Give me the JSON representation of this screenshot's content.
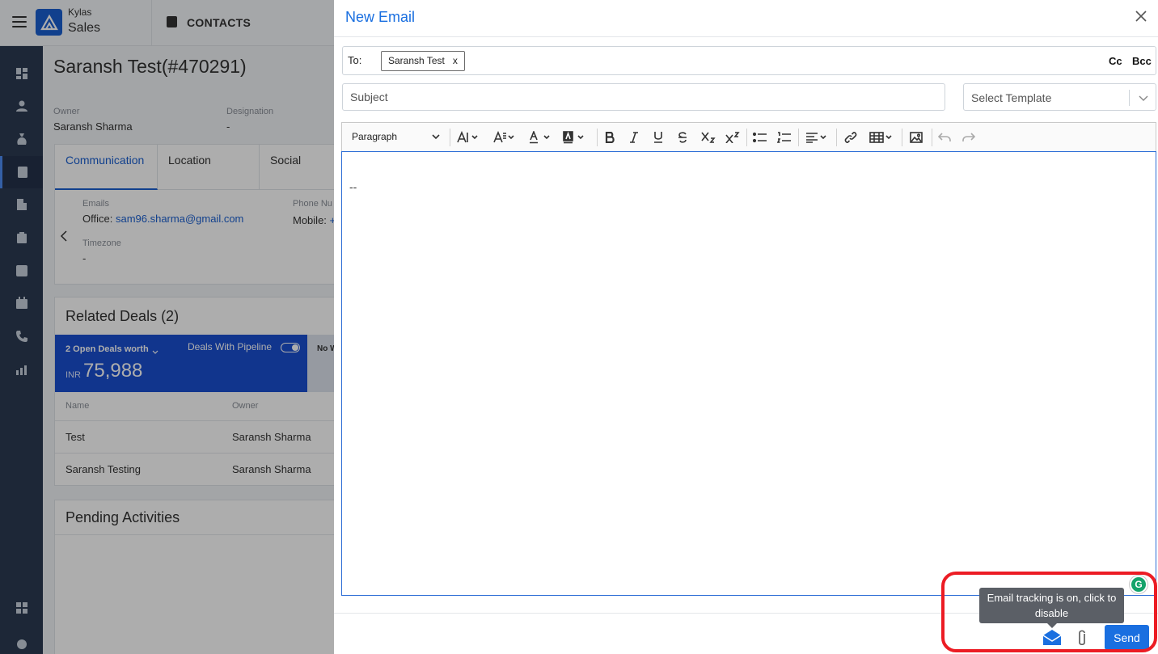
{
  "app": {
    "brand_top": "Kylas",
    "brand_main": "Sales",
    "section": "CONTACTS"
  },
  "sidebar": {
    "icons": [
      "dashboard-icon",
      "user-icon",
      "money-bag-icon",
      "contact-card-icon",
      "building-icon",
      "clipboard-icon",
      "checkbox-icon",
      "calendar-icon",
      "phone-icon",
      "report-icon",
      "apps-icon",
      "settings-icon"
    ],
    "active": "contact-card-icon"
  },
  "contact": {
    "title": "Saransh Test(#470291)",
    "owner_label": "Owner",
    "owner": "Saransh Sharma",
    "designation_label": "Designation",
    "designation": "-",
    "tabs": [
      "Communication",
      "Location",
      "Social"
    ],
    "emails_label": "Emails",
    "email_prefix": "Office:",
    "email": "sam96.sharma@gmail.com",
    "phone_label": "Phone Nu",
    "phone_prefix": "Mobile:",
    "phone_value": "+",
    "timezone_label": "Timezone",
    "timezone": "-"
  },
  "deals": {
    "heading": "Related Deals (2)",
    "open_label": "2 Open Deals worth",
    "currency": "INR",
    "amount": "75,988",
    "pipeline_label": "Deals With Pipeline",
    "truncated": "No W",
    "col_name": "Name",
    "col_owner": "Owner",
    "rows": [
      {
        "name": "Test",
        "owner": "Saransh Sharma"
      },
      {
        "name": "Saransh Testing",
        "owner": "Saransh Sharma"
      }
    ]
  },
  "activities": {
    "heading": "Pending Activities"
  },
  "email": {
    "title": "New Email",
    "to_label": "To:",
    "recipient": "Saransh Test",
    "chip_remove": "x",
    "cc_label": "Cc",
    "bcc_label": "Bcc",
    "subject_placeholder": "Subject",
    "template_placeholder": "Select Template",
    "paragraph_style": "Paragraph",
    "signature": "--",
    "tooltip": "Email tracking is on, click to disable",
    "send_label": "Send",
    "grammarly": "G"
  },
  "colors": {
    "accent": "#1a6fe0",
    "sidebar": "#2b3a52",
    "deal_band": "#1a4fd0",
    "tooltip": "#5b5f66",
    "highlight": "#ec1c24"
  }
}
